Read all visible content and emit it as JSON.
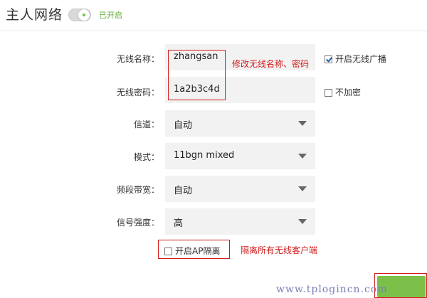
{
  "header": {
    "title": "主人网络",
    "toggle_status": "已开启"
  },
  "form": {
    "ssid_label": "无线名称：",
    "ssid_value": "zhangsan",
    "password_label": "无线密码：",
    "password_value": "1a2b3c4d",
    "channel_label": "信道：",
    "channel_value": "自动",
    "mode_label": "模式：",
    "mode_value": "11bgn mixed",
    "bandwidth_label": "频段带宽：",
    "bandwidth_value": "自动",
    "signal_label": "信号强度：",
    "signal_value": "高"
  },
  "options": {
    "broadcast_label": "开启无线广播",
    "broadcast_checked": true,
    "no_encrypt_label": "不加密",
    "no_encrypt_checked": false,
    "ap_isolation_label": "开启AP隔离",
    "ap_isolation_checked": false
  },
  "annotations": {
    "ssid_note": "修改无线名称、密码",
    "ap_note": "隔离所有无线客户端"
  },
  "watermark": "www.tplogincn.com",
  "colors": {
    "accent_green": "#7cc04a",
    "annotation_red": "#d21a1a"
  }
}
